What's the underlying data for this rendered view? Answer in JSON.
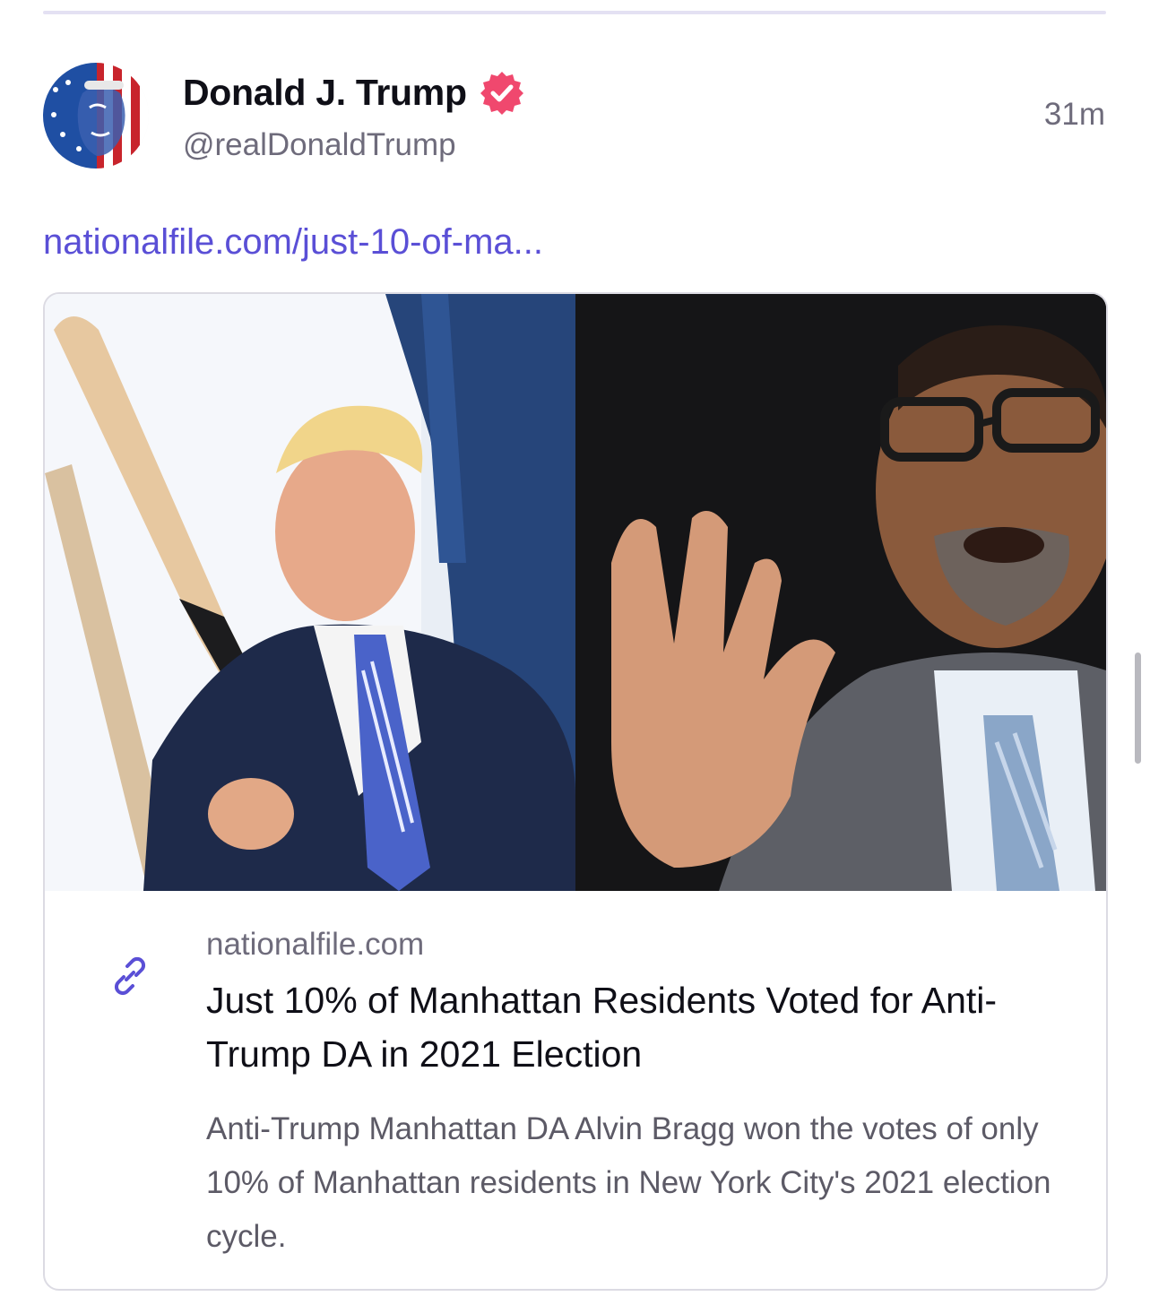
{
  "post": {
    "author_name": "Donald J. Trump",
    "handle": "@realDonaldTrump",
    "timestamp": "31m",
    "link_text": "nationalfile.com/just-10-of-ma..."
  },
  "card": {
    "domain": "nationalfile.com",
    "title": "Just 10% of Manhattan Residents Voted for Anti-Trump DA in 2021 Election",
    "description": "Anti-Trump Manhattan DA Alvin Bragg won the votes of only 10% of Manhattan residents in New York City's 2021 election cycle."
  },
  "colors": {
    "link": "#5a4fd6",
    "verified_badge": "#f0486e",
    "divider": "#e4e1f3"
  },
  "icons": {
    "verified": "verified-badge-icon",
    "link": "chain-link-icon"
  }
}
